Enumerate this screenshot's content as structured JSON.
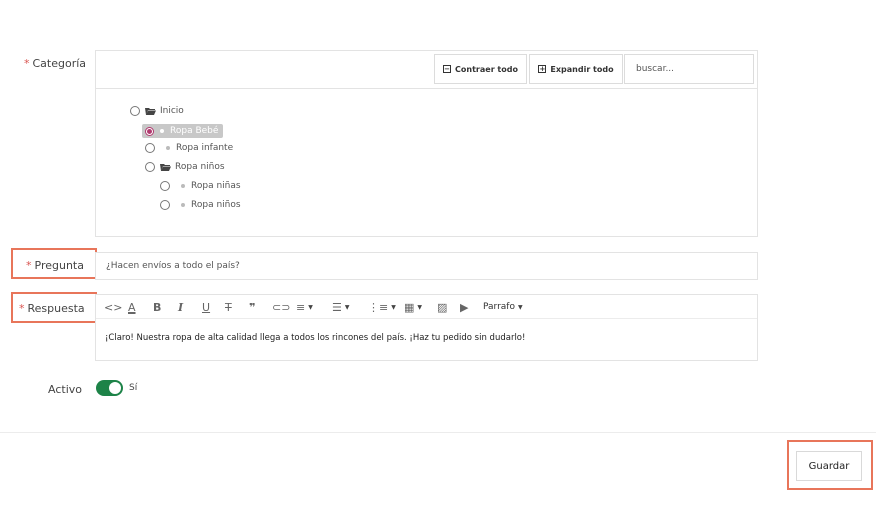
{
  "form": {
    "category": {
      "label": "Categoría",
      "required_mark": "*",
      "collapse_label": "Contraer todo",
      "expand_label": "Expandir todo",
      "search_placeholder": "buscar...",
      "tree": [
        {
          "label": "Inicio",
          "type": "folder",
          "level": 0,
          "selected": false
        },
        {
          "label": "Ropa Bebé",
          "type": "leaf",
          "level": 1,
          "selected": true
        },
        {
          "label": "Ropa infante",
          "type": "leaf",
          "level": 1,
          "selected": false
        },
        {
          "label": "Ropa niños",
          "type": "folder",
          "level": 1,
          "selected": false
        },
        {
          "label": "Ropa niñas",
          "type": "leaf",
          "level": 2,
          "selected": false
        },
        {
          "label": "Ropa niños",
          "type": "leaf",
          "level": 2,
          "selected": false
        }
      ]
    },
    "question": {
      "label": "Pregunta",
      "required_mark": "*",
      "value": "¿Hacen envíos a todo el país?"
    },
    "answer": {
      "label": "Respuesta",
      "required_mark": "*",
      "toolbar": {
        "paragraph_label": "Parrafo",
        "tools": [
          "code-view",
          "text-color",
          "bold",
          "italic",
          "underline",
          "strikethrough",
          "blockquote",
          "link",
          "align",
          "bullet-list",
          "numbered-list",
          "table",
          "image",
          "video"
        ]
      },
      "value": "¡Claro! Nuestra ropa de alta calidad llega a todos los rincones del país. ¡Haz tu pedido sin dudarlo!"
    },
    "active": {
      "label": "Activo",
      "value_label": "Sí",
      "on": true
    }
  },
  "footer": {
    "save_label": "Guardar"
  },
  "colors": {
    "highlight": "#e8755a",
    "required": "#d9534f",
    "toggle_on": "#1d8348",
    "selected_radio": "#b03a6e"
  }
}
